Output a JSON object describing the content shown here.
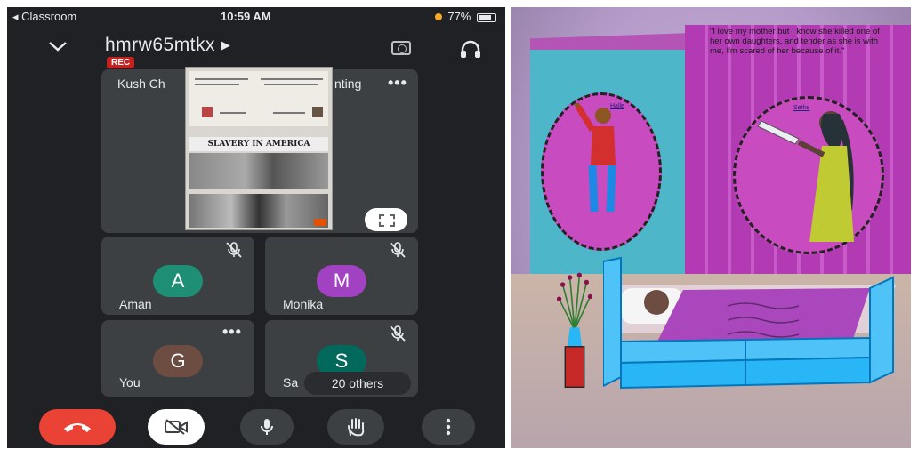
{
  "status_bar": {
    "carrier": "◂ Classroom",
    "time": "10:59 AM",
    "battery": "77%"
  },
  "meeting": {
    "code": "hmrw65mtkx ▸",
    "rec_label": "REC"
  },
  "presenter_tile": {
    "name": "Kush Ch",
    "name_suffix": "nting",
    "slide_title": "SLAVERY IN AMERICA"
  },
  "participants": [
    {
      "name": "Aman",
      "initial": "A",
      "color": "#1e8e75"
    },
    {
      "name": "Monika",
      "initial": "M",
      "color": "#a142c2"
    },
    {
      "name": "You",
      "initial": "G",
      "color": "#6d4c41"
    },
    {
      "name": "Sa",
      "initial": "S",
      "color": "#00695c"
    }
  ],
  "others_label": "20 others",
  "colors": {
    "meet_bg": "#202124",
    "tile_bg": "#3c4043",
    "end_call": "#ea4335"
  },
  "icons": [
    "chevron-down-icon",
    "switch-camera-icon",
    "headphones-icon",
    "more-icon",
    "mic-off-icon",
    "fullscreen-icon",
    "end-call-icon",
    "camera-off-icon",
    "mic-icon",
    "raise-hand-icon",
    "overflow-menu-icon"
  ],
  "painting": {
    "quote": "\"I love my mother but I know she killed one of her own daughters, and tender as she is with me, I'm scared of her because of it.\"",
    "label_left": "Halle",
    "label_right": "Sethe"
  }
}
